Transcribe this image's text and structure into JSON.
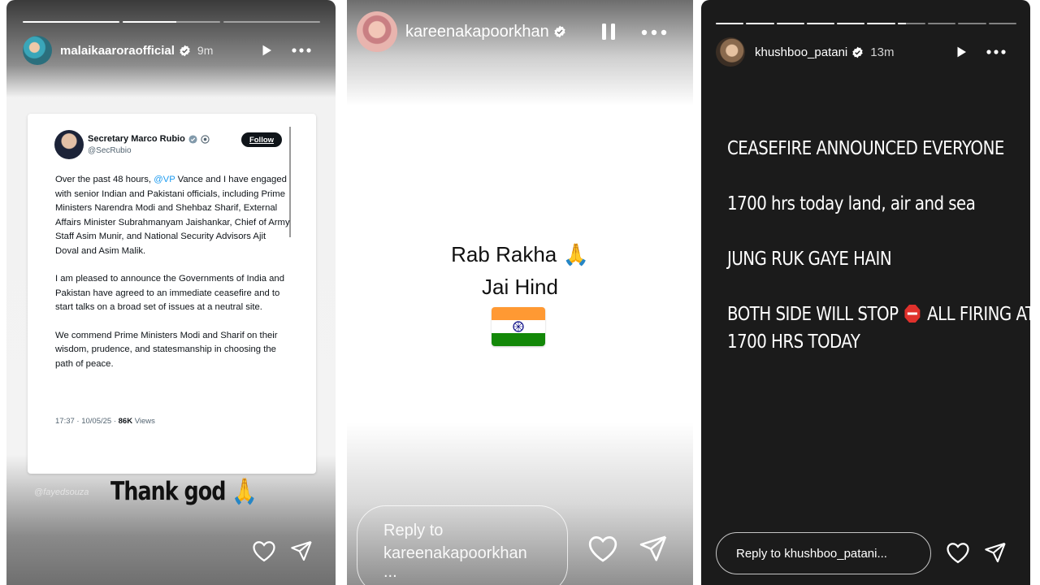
{
  "stories": [
    {
      "username": "malaikaaroraofficial",
      "time_ago": "9m",
      "tweet": {
        "author": "Secretary Marco Rubio",
        "handle": "@SecRubio",
        "follow_label": "Follow",
        "para1_pre": "Over the past 48 hours, ",
        "para1_mention": "@VP",
        "para1_post": " Vance and I have engaged with senior Indian and Pakistani officials, including Prime Ministers Narendra Modi and Shehbaz Sharif, External Affairs Minister Subrahmanyam Jaishankar, Chief of Army Staff Asim Munir, and National Security Advisors Ajit Doval and Asim Malik.",
        "para2": "I am pleased to announce the Governments of India and Pakistan have agreed to an immediate ceasefire and to start talks on a broad set of issues at a neutral site.",
        "para3": "We commend Prime Ministers Modi and Sharif on their wisdom, prudence, and statesmanship in choosing the path of peace.",
        "timestamp": "17:37 · 10/05/25 · ",
        "views_count": "86K",
        "views_label": " Views"
      },
      "watermark": "@fayedsouza",
      "caption": "Thank god 🙏"
    },
    {
      "username": "kareenakapoorkhan",
      "line1": "Rab Rakha 🙏",
      "line2": "Jai Hind",
      "reply_placeholder_1": "Reply to",
      "reply_placeholder_2": "kareenakapoorkhan",
      "reply_placeholder_3": "..."
    },
    {
      "username": "khushboo_patani",
      "time_ago": "13m",
      "lines": [
        "CEASEFIRE ANNOUNCED EVERYONE",
        "1700 hrs today land, air and sea",
        "JUNG RUK GAYE HAIN"
      ],
      "line4_pre": "BOTH SIDE WILL STOP",
      "line4_post": "ALL FIRING AT",
      "line5": "1700 HRS TODAY",
      "reply_placeholder": "Reply to khushboo_patani..."
    }
  ],
  "progress": {
    "story1": [
      1,
      0.5,
      0
    ],
    "story3": [
      1,
      1,
      1,
      1,
      1,
      1,
      0.3,
      0,
      0,
      0
    ]
  },
  "icons": {
    "play": "play-icon",
    "pause": "pause-icon",
    "more": "more-options-icon",
    "like": "heart-icon",
    "share": "send-icon",
    "verified": "verified-badge-icon"
  },
  "colors": {
    "verified": "#ffffff",
    "mention": "#1d9bf0",
    "flag_saffron": "#ff9933",
    "flag_green": "#138808",
    "chakra": "#000080",
    "stop_red": "#e0312c"
  }
}
